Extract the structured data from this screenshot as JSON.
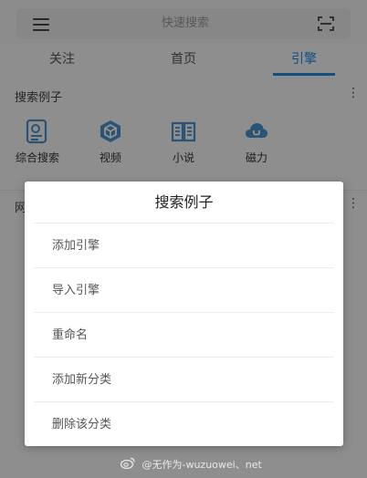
{
  "topbar": {
    "search_placeholder": "快速搜索",
    "menu_icon": "hamburger-menu-icon",
    "scan_icon": "scan-icon"
  },
  "tabs": [
    {
      "label": "关注",
      "active": false
    },
    {
      "label": "首页",
      "active": false
    },
    {
      "label": "引擎",
      "active": true
    }
  ],
  "section": {
    "title": "搜索例子",
    "more": "⋮",
    "engines": [
      {
        "label": "综合搜索",
        "icon": "composite-search-icon"
      },
      {
        "label": "视频",
        "icon": "video-cube-icon"
      },
      {
        "label": "小说",
        "icon": "book-icon"
      },
      {
        "label": "磁力",
        "icon": "cloud-magnet-icon"
      }
    ]
  },
  "section2": {
    "title_partial": "网",
    "more": "⋮"
  },
  "dialog": {
    "title": "搜索例子",
    "items": [
      {
        "label": "添加引擎"
      },
      {
        "label": "导入引擎"
      },
      {
        "label": "重命名"
      },
      {
        "label": "添加新分类"
      },
      {
        "label": "删除该分类"
      }
    ]
  },
  "watermark": {
    "text": "@无作为-wuzuowei、net"
  },
  "colors": {
    "accent": "#1e88e5",
    "icon": "#4a90c8",
    "overlay": "rgba(0,0,0,0.42)"
  }
}
